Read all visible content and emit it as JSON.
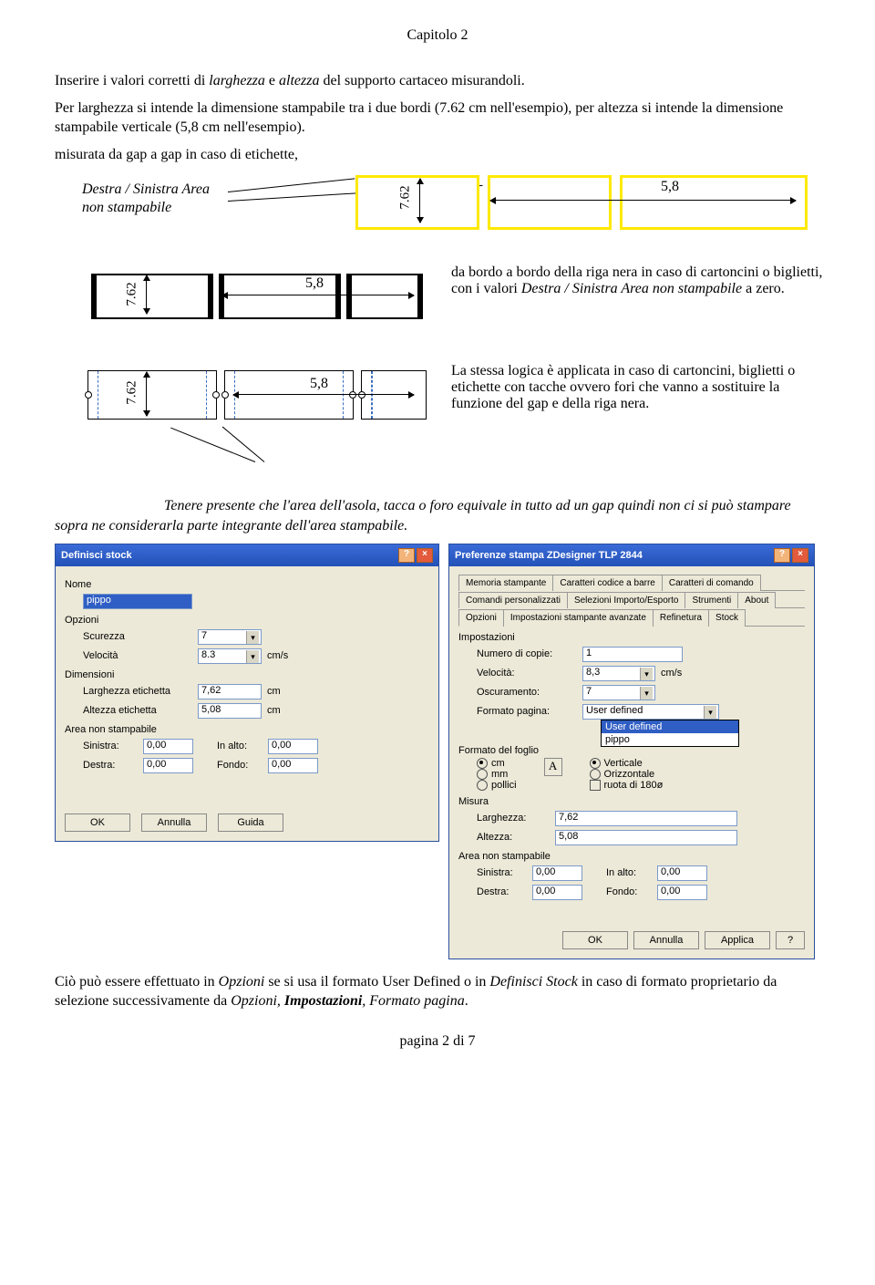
{
  "chapter": "Capitolo 2",
  "p1a": "Inserire i valori corretti di ",
  "p1b": "larghezza",
  "p1c": " e ",
  "p1d": "altezza",
  "p1e": " del supporto cartaceo misurandoli.",
  "p2": "Per larghezza si intende la dimensione stampabile tra i due bordi (7.62 cm nell'esempio), per altezza si intende la dimensione stampabile verticale (5,8 cm nell'esempio).",
  "p3": "misurata da gap a gap in caso di etichette,",
  "diagA_caption_l1": "Destra / Sinistra Area",
  "diagA_caption_l2": "non stampabile",
  "dim_v": "7.62",
  "dim_h": "5,8",
  "diagB_text_a": "da bordo a bordo della riga nera in caso di cartoncini o biglietti, con i valori ",
  "diagB_text_b": "Destra  / Sinistra Area non stampabile",
  "diagB_text_c": " a zero.",
  "diagC_text": "La stessa logica è applicata in caso di cartoncini, biglietti o etichette con tacche ovvero fori che vanno a sostituire la funzione del gap e della riga nera.",
  "note_a": "Tenere presente che l'area dell'asola, tacca o foro equivale in tutto ad un gap quindi non ci si può stampare sopra ne considerarla parte integrante dell'area stampabile.",
  "note_prefix_blank": "                            ",
  "dlg1": {
    "title": "Definisci stock",
    "nome_lbl": "Nome",
    "nome_val": "pippo",
    "opzioni_lbl": "Opzioni",
    "scurezza_lbl": "Scurezza",
    "scurezza_val": "7",
    "velocita_lbl": "Velocità",
    "velocita_val": "8.3",
    "velocita_unit": "cm/s",
    "dimensioni_lbl": "Dimensioni",
    "larghezza_lbl": "Larghezza etichetta",
    "larghezza_val": "7,62",
    "altezza_lbl": "Altezza etichetta",
    "altezza_val": "5,08",
    "unit_cm": "cm",
    "area_lbl": "Area non stampabile",
    "sinistra_lbl": "Sinistra:",
    "destra_lbl": "Destra:",
    "inalto_lbl": "In alto:",
    "fondo_lbl": "Fondo:",
    "zero": "0,00",
    "ok": "OK",
    "annulla": "Annulla",
    "guida": "Guida"
  },
  "dlg2": {
    "title": "Preferenze stampa ZDesigner TLP 2844",
    "tabs_row1": [
      "Memoria stampante",
      "Caratteri codice a barre",
      "Caratteri di comando"
    ],
    "tabs_row2": [
      "Comandi personalizzati",
      "Selezioni Importo/Esporto",
      "Strumenti",
      "About"
    ],
    "tabs_row3": [
      "Opzioni",
      "Impostazioni stampante avanzate",
      "Refinetura",
      "Stock"
    ],
    "imp_lbl": "Impostazioni",
    "copie_lbl": "Numero di copie:",
    "copie_val": "1",
    "velocita_lbl": "Velocità:",
    "velocita_val": "8,3",
    "velocita_unit": "cm/s",
    "osc_lbl": "Oscuramento:",
    "osc_val": "7",
    "formato_lbl": "Formato pagina:",
    "formato_val": "User defined",
    "formato_opts": [
      "User defined",
      "pippo"
    ],
    "foglio_lbl": "Formato del foglio",
    "r_cm": "cm",
    "r_mm": "mm",
    "r_pol": "pollici",
    "r_vert": "Verticale",
    "r_oriz": "Orizzontale",
    "r_rot": "ruota di 180ø",
    "misura_lbl": "Misura",
    "larghezza_lbl": "Larghezza:",
    "larghezza_val": "7,62",
    "altezza_lbl": "Altezza:",
    "altezza_val": "5,08",
    "area_lbl": "Area non stampabile",
    "sinistra_lbl": "Sinistra:",
    "destra_lbl": "Destra:",
    "inalto_lbl": "In alto:",
    "fondo_lbl": "Fondo:",
    "zero": "0,00",
    "ok": "OK",
    "annulla": "Annulla",
    "applica": "Applica",
    "help": "?"
  },
  "closing_a": "Ciò può essere effettuato in ",
  "closing_b": "Opzioni",
  "closing_c": " se si usa il formato User Defined o in ",
  "closing_d": "Definisci Stock",
  "closing_e": " in caso di formato proprietario da selezione successivamente da ",
  "closing_f": "Opzioni, ",
  "closing_g": "Impostazioni",
  "closing_h": ", ",
  "closing_i": "Formato pagina",
  "closing_j": ".",
  "footer": "pagina 2 di 7"
}
